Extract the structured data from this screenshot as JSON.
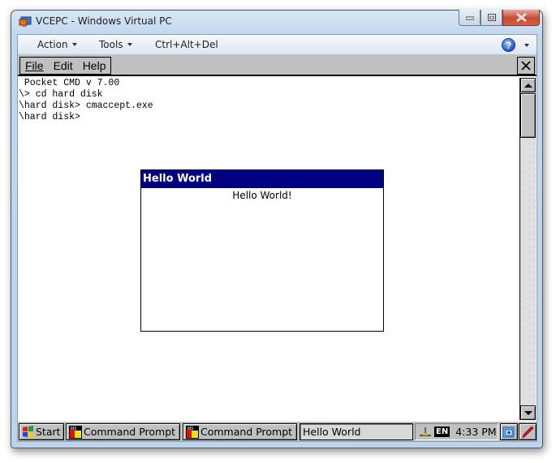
{
  "window": {
    "title": "VCEPC - Windows Virtual PC",
    "controls": [
      "minimize",
      "maximize",
      "close"
    ]
  },
  "vpc_toolbar": {
    "action_label": "Action",
    "tools_label": "Tools",
    "ctrl_alt_del_label": "Ctrl+Alt+Del",
    "help_icon": "?"
  },
  "ce_menubar": {
    "file_label": "File",
    "edit_label": "Edit",
    "help_label": "Help",
    "close_glyph": "✕"
  },
  "console": {
    "lines": [
      " Pocket CMD v 7.00",
      "\\> cd hard disk",
      "\\hard disk> cmaccept.exe",
      "\\hard disk>"
    ]
  },
  "dialog": {
    "title": "Hello World",
    "message": "Hello World!"
  },
  "taskbar": {
    "start_label": "Start",
    "buttons": [
      {
        "label": "Command Prompt"
      },
      {
        "label": "Command Prompt"
      },
      {
        "label": "Hello World",
        "active": true
      }
    ],
    "tray": {
      "language": "EN",
      "time": "4:33 PM"
    }
  },
  "colors": {
    "dialog_title_bg": "#000080",
    "ce_gray": "#c0c0c0",
    "close_red": "#c84a33"
  }
}
